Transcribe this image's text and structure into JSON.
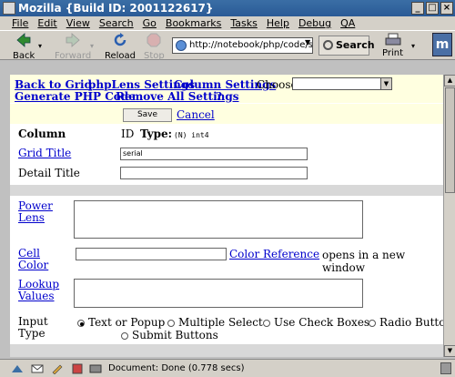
{
  "window": {
    "title": "Mozilla {Build ID: 2001122617}"
  },
  "menu": [
    "File",
    "Edit",
    "View",
    "Search",
    "Go",
    "Bookmarks",
    "Tasks",
    "Help",
    "Debug",
    "QA"
  ],
  "toolbar": {
    "back": "Back",
    "forward": "Forward",
    "reload": "Reload",
    "stop": "Stop",
    "url": "http://notebook/php/code/samp",
    "search": "Search",
    "print": "Print"
  },
  "nav": {
    "back_to_grid": "Back to Grid",
    "phplens_settings": "phpLens Settings",
    "column_settings": "Column Settings",
    "choose": "Choose",
    "choose_value": "",
    "generate_php": "Generate PHP Code",
    "remove_all": "Remove All Settings",
    "help": "?"
  },
  "form": {
    "save": "Save",
    "cancel": "Cancel",
    "column_label": "Column",
    "column_value": "ID",
    "type_label": "Type:",
    "type_value": "(N) int4",
    "grid_title_label": "Grid Title",
    "grid_title_value": "serial",
    "detail_title_label": "Detail Title",
    "detail_title_value": "",
    "power_lens_label": "Power Lens",
    "cell_color_label": "Cell Color",
    "color_reference": "Color Reference",
    "color_ref_note": "opens in a new window",
    "lookup_values_label": "Lookup Values",
    "input_type_label": "Input Type",
    "input_options": [
      {
        "label": "Text or Popup",
        "selected": true
      },
      {
        "label": "Multiple Select",
        "selected": false
      },
      {
        "label": "Use Check Boxes",
        "selected": false
      },
      {
        "label": "Radio Buttons",
        "selected": false
      },
      {
        "label": "Submit Buttons",
        "selected": false
      }
    ]
  },
  "status": {
    "text": "Document: Done (0.778 secs)"
  }
}
